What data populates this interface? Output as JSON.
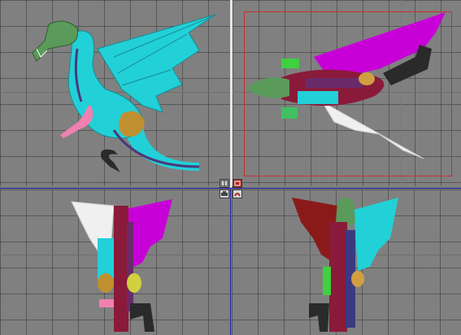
{
  "app": {
    "view_layout": "four-viewport"
  },
  "viewports": [
    {
      "id": "side-view",
      "label": ""
    },
    {
      "id": "top-view",
      "label": ""
    },
    {
      "id": "back-view",
      "label": ""
    },
    {
      "id": "front-view",
      "label": ""
    }
  ],
  "colors": {
    "background": "#808080",
    "grid_line": "#373737",
    "divider_blue": "#2020a8",
    "camera_frame": "#c83030",
    "dragon_body": "#22d0d8",
    "dragon_head": "#5a9a5a",
    "dragon_belly": "#f080b0",
    "dragon_claw": "#c09030",
    "dragon_tail_stripe": "#2a2a2a",
    "wing_right": "#c800d8",
    "wing_left": "#f0f0f0",
    "wing_front_red": "#8a1a1a"
  },
  "controls": {
    "icons": [
      "viewport-layout-icon",
      "maximize-icon",
      "print-icon",
      "camera-icon"
    ]
  }
}
